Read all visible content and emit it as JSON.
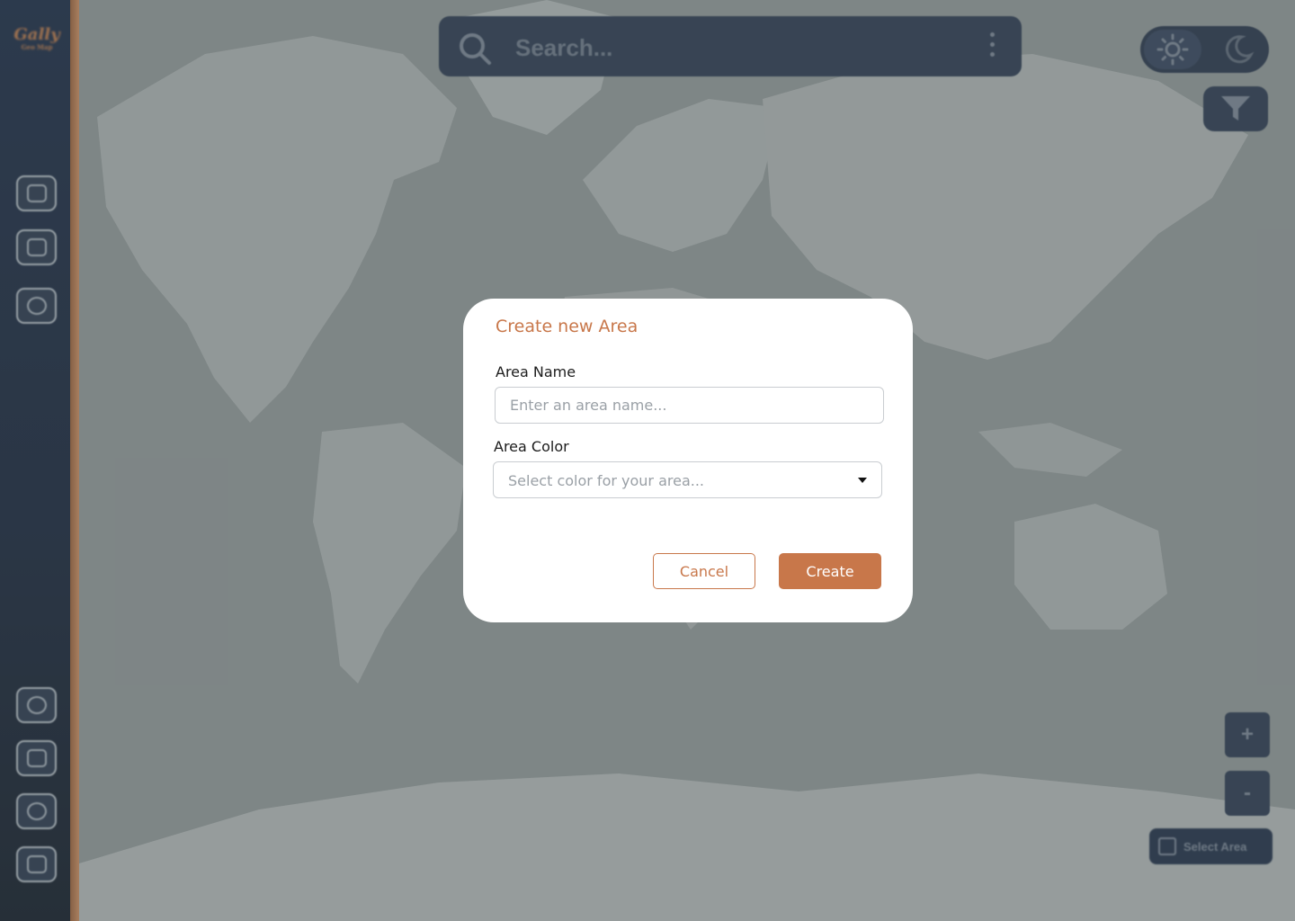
{
  "search": {
    "placeholder": "Search..."
  },
  "map_controls": {
    "zoom_in_label": "+",
    "zoom_out_label": "-",
    "select_area_label": "Select Area"
  },
  "logo": {
    "text": "Gally",
    "sub": "Geo Map"
  },
  "modal": {
    "title": "Create new Area",
    "name_label": "Area Name",
    "name_placeholder": "Enter an area name...",
    "name_value": "",
    "color_label": "Area Color",
    "color_placeholder": "Select color for your area...",
    "cancel_label": "Cancel",
    "create_label": "Create"
  },
  "colors": {
    "accent": "#c8774a",
    "sidebar": "#1b2a4a",
    "overlay": "#465052"
  }
}
